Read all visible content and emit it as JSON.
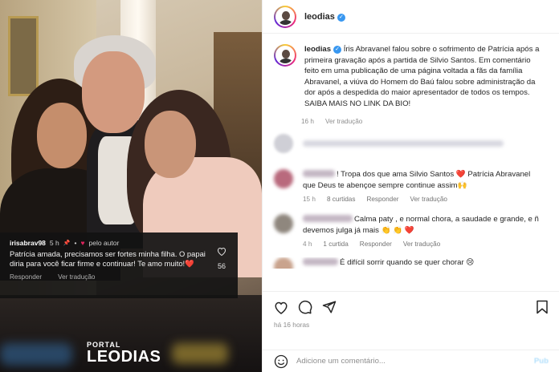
{
  "post": {
    "username": "leodias",
    "caption": "Íris Abravanel falou sobre o sofrimento de Patrícia após a primeira gravação após a partida de Silvio Santos. Em comentário feito em uma publicação de uma página voltada a fãs da família Abravanel, a viúva do Homem do Baú falou sobre administração da dor após a despedida do maior apresentador de todos os tempos. SAIBA MAIS NO LINK DA BIO!",
    "caption_time": "16 h",
    "caption_translate": "Ver tradução",
    "time_ago": "há 16 horas"
  },
  "photo": {
    "comment": {
      "user": "irisabrav98",
      "time": "5 h",
      "pin": "📌",
      "by_author": "pelo autor",
      "text": "Patrícia amada, precisamos ser fortes minha filha. O papai diria para você ficar firme e continuar! Te amo muito!❤️",
      "likes": "56",
      "reply": "Responder",
      "translate": "Ver tradução"
    },
    "watermark": {
      "line1": "PORTAL",
      "line2": "LEODIAS"
    }
  },
  "comments": [
    {
      "text": "! Tropa dos que ama Silvio Santos ❤️ Patrícia Abravanel que Deus te abençoe sempre continue assim🙌",
      "time": "15 h",
      "likes": "8 curtidas",
      "reply": "Responder",
      "translate": "Ver tradução",
      "avatar_color": "#b96a7d"
    },
    {
      "text": "Calma paty , e normal chora, a saudade e grande, e ñ devemos julga já mais 👏 👏 ❤️",
      "time": "4 h",
      "likes": "1 curtida",
      "reply": "Responder",
      "translate": "Ver tradução",
      "avatar_color": "#8f877e"
    },
    {
      "text": "É difícil sorrir quando se quer chorar 😢",
      "avatar_color": "#c9a38d"
    }
  ],
  "add_comment": {
    "placeholder": "Adicione um comentário...",
    "publish": "Pub"
  },
  "icons": [
    "heart-icon",
    "comment-icon",
    "share-icon",
    "bookmark-icon",
    "emoji-icon",
    "verified-icon"
  ],
  "colors": {
    "verified": "#3897f0",
    "secondary_text": "#8e8e8e",
    "heart": "#e0245e"
  }
}
